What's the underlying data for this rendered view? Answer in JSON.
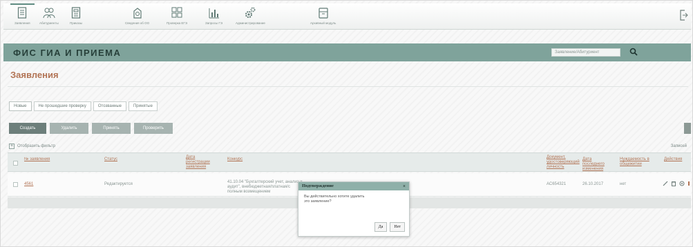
{
  "toolbar": {
    "tools": [
      {
        "label": "Заявления",
        "icon": "document-icon"
      },
      {
        "label": "Абитуриенты",
        "icon": "users-icon"
      },
      {
        "label": "Приказы",
        "icon": "orders-icon"
      },
      {
        "label": "Сведения об ОО",
        "icon": "institution-icon"
      },
      {
        "label": "Проверка ЕГЭ",
        "icon": "exam-check-icon"
      },
      {
        "label": "Запросы ГЭ",
        "icon": "queries-icon"
      },
      {
        "label": "Администрирование",
        "icon": "admin-gear-icon"
      },
      {
        "label": "Архивный модуль",
        "icon": "archive-icon"
      }
    ],
    "exit_icon": "exit-icon"
  },
  "header": {
    "title": "ФИС ГИА И ПРИЕМА",
    "search_placeholder": "Заявление/Абитуриент"
  },
  "page": {
    "title": "Заявления"
  },
  "tabs": [
    "Новые",
    "Не прошедшие проверку",
    "Отозванные",
    "Принятые"
  ],
  "actions": {
    "buttons": [
      "Создать",
      "Удалить",
      "Принять",
      "Проверить"
    ]
  },
  "filter": {
    "label": "Отобразить фильтр",
    "found": "Записей"
  },
  "table": {
    "headers": [
      "№ заявления",
      "Статус",
      "Дата регистрации заявления",
      "Конкурс",
      "Документ, удостоверяющий личность",
      "Дата последнего изменения",
      "Нуждаемость в общежитии",
      "Действия"
    ],
    "rows": [
      {
        "number": "4561",
        "status": "Редактируется",
        "date": "",
        "contest": "41.10.04 \"Бухгалтерский учет, анализ и аудит\", внебюджетная/платная/с полным возмещением",
        "document": "АС654321",
        "changed": "26.10.2017",
        "dormitory": "нет"
      }
    ]
  },
  "modal": {
    "title": "Подтверждение",
    "close": "×",
    "message": "Вы действительно хотите удалить это заявление?",
    "yes": "Да",
    "no": "Нет"
  },
  "colors": {
    "header": "#7fa39b",
    "accent": "#b27455",
    "modal_header": "#8fb0a9"
  }
}
